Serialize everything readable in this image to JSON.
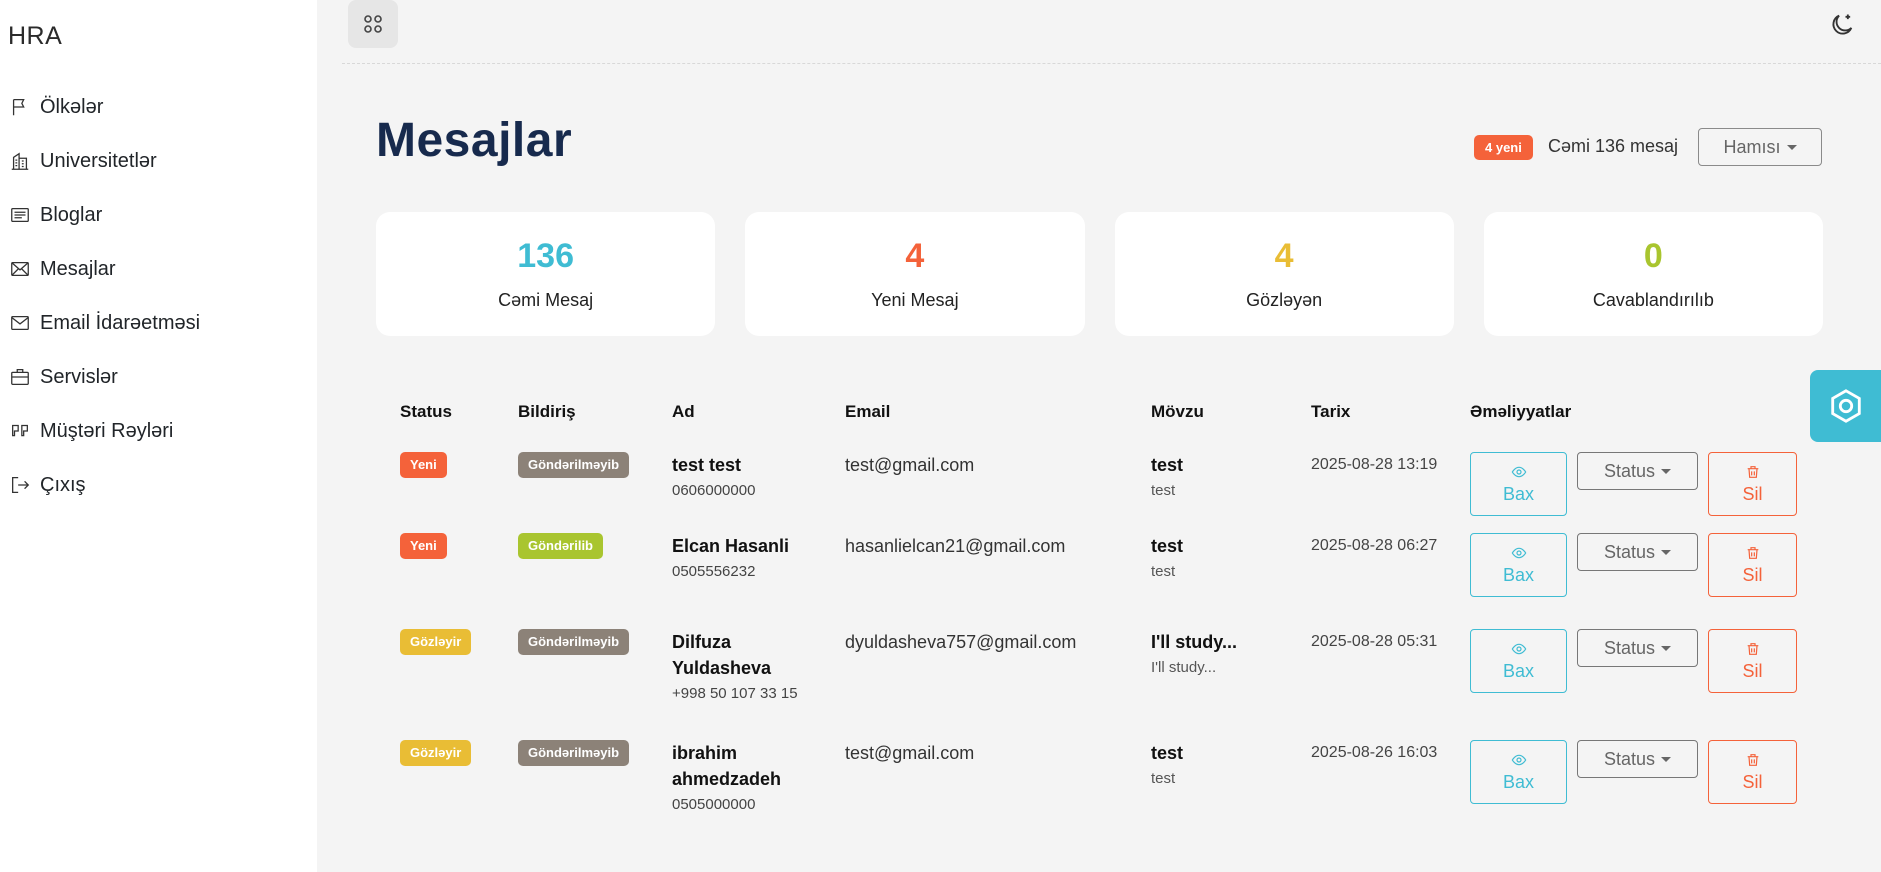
{
  "app": {
    "brand": "HRA"
  },
  "sidebar": {
    "items": [
      {
        "label": "Ölkələr",
        "icon": "flag-icon"
      },
      {
        "label": "Universitetlər",
        "icon": "building-icon"
      },
      {
        "label": "Bloglar",
        "icon": "newspaper-icon"
      },
      {
        "label": "Mesajlar",
        "icon": "envelope-open-icon"
      },
      {
        "label": "Email İdarəetməsi",
        "icon": "envelope-icon"
      },
      {
        "label": "Servislər",
        "icon": "briefcase-icon"
      },
      {
        "label": "Müştəri Rəyləri",
        "icon": "quote-icon"
      },
      {
        "label": "Çıxış",
        "icon": "logout-icon"
      }
    ]
  },
  "header": {
    "title": "Mesajlar",
    "new_badge": "4 yeni",
    "total_text": "Cəmi 136 mesaj",
    "filter_label": "Hamısı"
  },
  "stats": [
    {
      "value": "136",
      "label": "Cəmi Mesaj",
      "color": "#3fbcd3"
    },
    {
      "value": "4",
      "label": "Yeni Mesaj",
      "color": "#f4623a"
    },
    {
      "value": "4",
      "label": "Gözləyən",
      "color": "#e9bd35"
    },
    {
      "value": "0",
      "label": "Cavablandırılıb",
      "color": "#a9c52f"
    }
  ],
  "table": {
    "columns": [
      "Status",
      "Bildiriş",
      "Ad",
      "Email",
      "Mövzu",
      "Tarix",
      "Əməliyyatlar"
    ],
    "actions": {
      "view": "Bax",
      "status": "Status",
      "delete": "Sil"
    },
    "rows": [
      {
        "status": "Yeni",
        "status_color": "#f4623a",
        "notify": "Göndərilməyib",
        "notify_color": "#8c8278",
        "name": "test test",
        "phone": "0606000000",
        "email": "test@gmail.com",
        "subject": "test",
        "subject_preview": "test",
        "date": "2025-08-28 13:19"
      },
      {
        "status": "Yeni",
        "status_color": "#f4623a",
        "notify": "Göndərilib",
        "notify_color": "#a9c52f",
        "name": "Elcan Hasanli",
        "phone": "0505556232",
        "email": "hasanlielcan21@gmail.com",
        "subject": "test",
        "subject_preview": "test",
        "date": "2025-08-28 06:27"
      },
      {
        "status": "Gözləyir",
        "status_color": "#e9bd35",
        "notify": "Göndərilməyib",
        "notify_color": "#8c8278",
        "name": "Dilfuza Yuldasheva",
        "phone": "+998 50 107 33 15",
        "email": "dyuldasheva757@gmail.com",
        "subject": "I'll study...",
        "subject_preview": "I'll study...",
        "date": "2025-08-28 05:31"
      },
      {
        "status": "Gözləyir",
        "status_color": "#e9bd35",
        "notify": "Göndərilməyib",
        "notify_color": "#8c8278",
        "name": "ibrahim ahmedzadeh",
        "phone": "0505000000",
        "email": "test@gmail.com",
        "subject": "test",
        "subject_preview": "test",
        "date": "2025-08-26 16:03"
      }
    ]
  }
}
